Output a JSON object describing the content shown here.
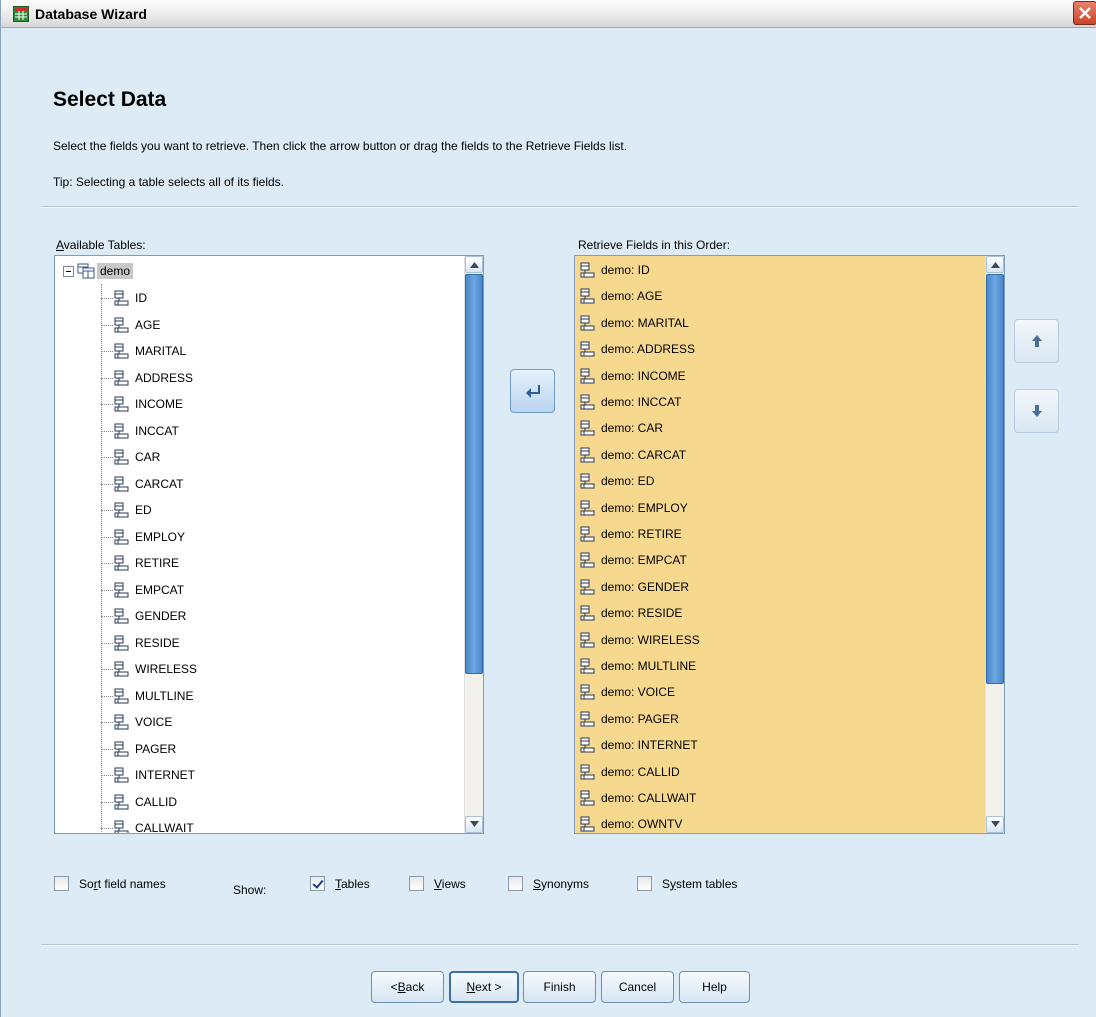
{
  "window": {
    "title": "Database Wizard",
    "title_icon": "table-icon",
    "close_icon": "close-icon"
  },
  "header": {
    "title": "Select Data",
    "instruction": "Select the fields you want to retrieve. Then click the arrow button or drag the fields to the Retrieve Fields list.",
    "tip": "Tip: Selecting a table selects all of its fields."
  },
  "available": {
    "label_prefix": "",
    "label_hotkey": "A",
    "label_rest": "vailable Tables:",
    "table": "demo",
    "fields": [
      "ID",
      "AGE",
      "MARITAL",
      "ADDRESS",
      "INCOME",
      "INCCAT",
      "CAR",
      "CARCAT",
      "ED",
      "EMPLOY",
      "RETIRE",
      "EMPCAT",
      "GENDER",
      "RESIDE",
      "WIRELESS",
      "MULTLINE",
      "VOICE",
      "PAGER",
      "INTERNET",
      "CALLID",
      "CALLWAIT"
    ]
  },
  "retrieve": {
    "label": "Retrieve Fields in this Order:",
    "fields": [
      "demo: ID",
      "demo: AGE",
      "demo: MARITAL",
      "demo: ADDRESS",
      "demo: INCOME",
      "demo: INCCAT",
      "demo: CAR",
      "demo: CARCAT",
      "demo: ED",
      "demo: EMPLOY",
      "demo: RETIRE",
      "demo: EMPCAT",
      "demo: GENDER",
      "demo: RESIDE",
      "demo: WIRELESS",
      "demo: MULTLINE",
      "demo: VOICE",
      "demo: PAGER",
      "demo: INTERNET",
      "demo: CALLID",
      "demo: CALLWAIT",
      "demo: OWNTV"
    ]
  },
  "options": {
    "sort": {
      "pre": "So",
      "hot": "r",
      "post": "t field names",
      "checked": false
    },
    "show_label": "Show:",
    "tables": {
      "pre": "",
      "hot": "T",
      "post": "ables",
      "checked": true
    },
    "views": {
      "pre": "",
      "hot": "V",
      "post": "iews",
      "checked": false
    },
    "synonyms": {
      "pre": "",
      "hot": "S",
      "post": "ynonyms",
      "checked": false
    },
    "system": {
      "pre": "S",
      "hot": "y",
      "post": "stem tables",
      "checked": false
    }
  },
  "buttons": {
    "back": {
      "pre": "< ",
      "hot": "B",
      "post": "ack"
    },
    "next": {
      "pre": "",
      "hot": "N",
      "post": "ext >"
    },
    "finish": "Finish",
    "cancel": "Cancel",
    "help": "Help"
  },
  "colors": {
    "retrieve_bg": "#f6d98f",
    "dialog_bg": "#dcebf6",
    "scroll_thumb": "#4a87cc"
  }
}
